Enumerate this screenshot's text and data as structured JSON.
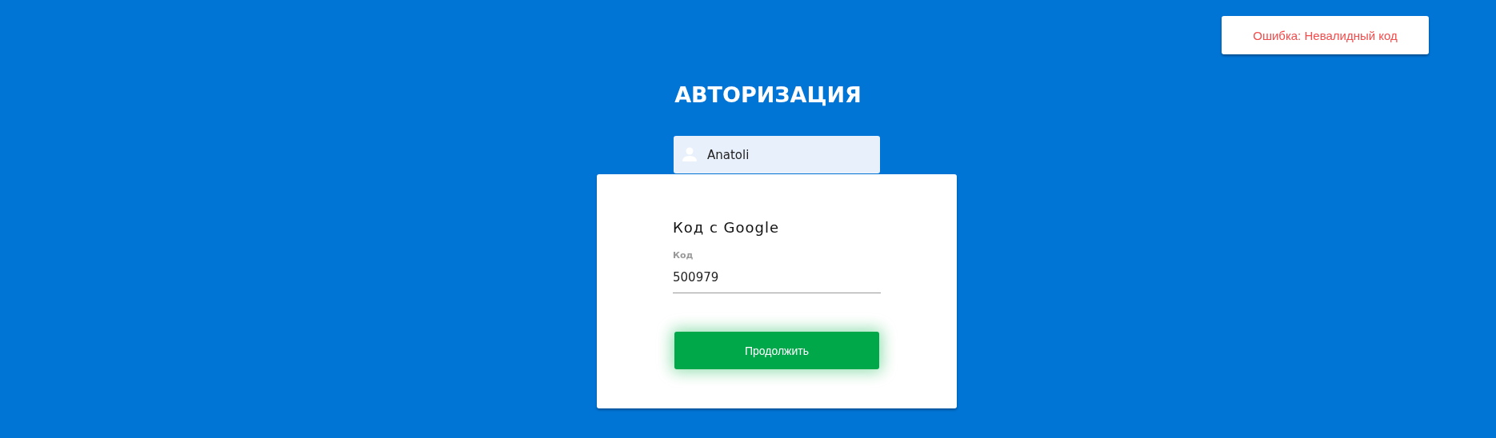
{
  "notification": {
    "kind": "error",
    "text": "Ошибка: Невалидный код"
  },
  "title": "АВТОРИЗАЦИЯ",
  "username": {
    "value": "Anatoli"
  },
  "card": {
    "heading": "Код с Google",
    "code_field": {
      "label": "Код",
      "value": "500979"
    },
    "submit_button": "Продолжить"
  }
}
